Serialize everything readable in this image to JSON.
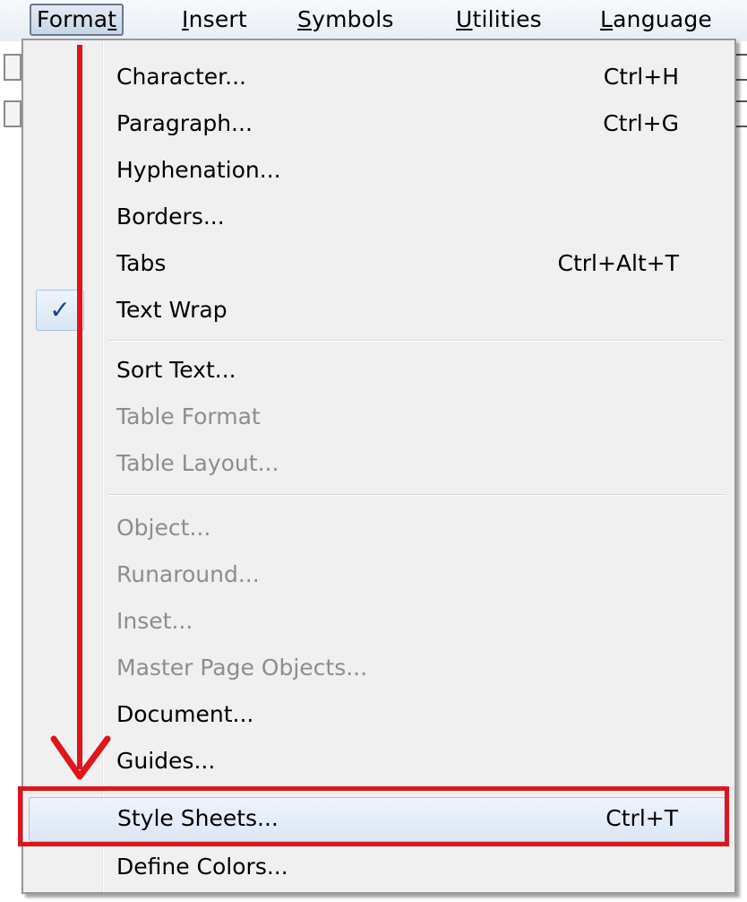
{
  "menubar": {
    "items": [
      {
        "pre": "Forma",
        "acc": "t",
        "post": "",
        "active": true
      },
      {
        "pre": "",
        "acc": "I",
        "post": "nsert"
      },
      {
        "pre": "",
        "acc": "S",
        "post": "ymbols"
      },
      {
        "pre": "",
        "acc": "U",
        "post": "tilities"
      },
      {
        "pre": "",
        "acc": "L",
        "post": "anguage"
      }
    ]
  },
  "menu": {
    "items": [
      {
        "label": "Character...",
        "shortcut": "Ctrl+H"
      },
      {
        "label": "Paragraph...",
        "shortcut": "Ctrl+G"
      },
      {
        "label": "Hyphenation...",
        "shortcut": ""
      },
      {
        "label": "Borders...",
        "shortcut": ""
      },
      {
        "label": "Tabs",
        "shortcut": "Ctrl+Alt+T"
      },
      {
        "label": "Text Wrap",
        "shortcut": "",
        "checked": true,
        "check_glyph": "✓"
      },
      {
        "label": "Sort Text...",
        "shortcut": ""
      },
      {
        "label": "Table Format",
        "shortcut": "",
        "disabled": true
      },
      {
        "label": "Table Layout...",
        "shortcut": "",
        "disabled": true
      },
      {
        "label": "Object...",
        "shortcut": "",
        "disabled": true
      },
      {
        "label": "Runaround...",
        "shortcut": "",
        "disabled": true
      },
      {
        "label": "Inset...",
        "shortcut": "",
        "disabled": true
      },
      {
        "label": "Master Page Objects...",
        "shortcut": "",
        "disabled": true
      },
      {
        "label": "Document...",
        "shortcut": ""
      },
      {
        "label": "Guides...",
        "shortcut": ""
      },
      {
        "label": "Style Sheets...",
        "shortcut": "Ctrl+T",
        "highlighted": true
      },
      {
        "label": "Define Colors...",
        "shortcut": ""
      }
    ]
  },
  "annotation": {
    "color": "#e0141c",
    "arrow_icon": "down-arrow-icon",
    "highlight_target": "Style Sheets..."
  }
}
